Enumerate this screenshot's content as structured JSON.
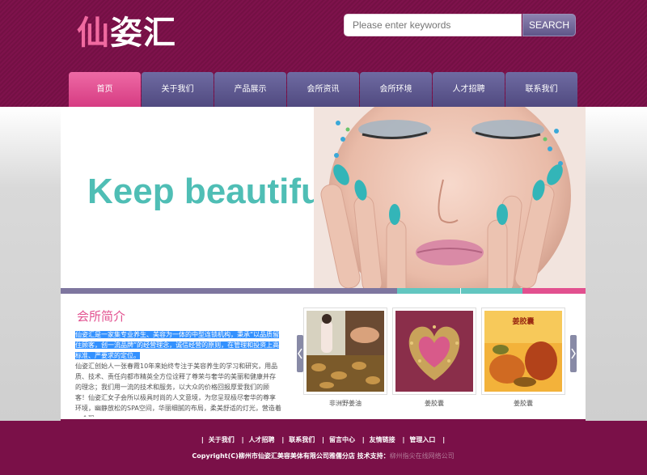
{
  "header": {
    "logo_first": "仙",
    "logo_rest": "姿汇",
    "search_placeholder": "Please enter keywords",
    "search_button": "SEARCH"
  },
  "nav": {
    "items": [
      "首页",
      "关于我们",
      "产品展示",
      "会所资讯",
      "会所环境",
      "人才招聘",
      "联系我们"
    ],
    "active_index": 0
  },
  "banner": {
    "text": "Keep beautiful"
  },
  "strip_colors": [
    "#7e769f",
    "#62c6c0",
    "#e2508f"
  ],
  "intro": {
    "title": "会所简介",
    "highlight": "仙姿汇是一家集专业养生、美容为一体的中型连锁机构，秉承“以品质留住顾客，创一流品牌”的经营理念，诚信经营的原则，在管理和投资上高标准、严要求的定位。",
    "body": "仙姿汇创始人一张春霞10年来始终专注于美容养生的学习和研究，用品质、技术、责任向都市精英全方位诠释了尊荣与奢华的美丽和健康并存的理念；我们用一流的技术和服务，以大众的价格回报厚爱我们的顾客！仙姿汇女子会所以极具时尚的人文意境，为您呈现极尽奢华的尊享环境，幽静放松的SPA空间，华丽细腻的布局，柔美舒适的灯光，营造着一个现"
  },
  "products": [
    {
      "caption": "非洲野姜油"
    },
    {
      "caption": "姜胶囊"
    },
    {
      "caption": "姜胶囊",
      "label": "姜胶囊"
    }
  ],
  "footer": {
    "links": [
      "关于我们",
      "人才招聘",
      "联系我们",
      "留言中心",
      "友情链接",
      "管理入口"
    ],
    "copyright": "Copyright(C)柳州市仙姿汇美容美体有限公司雅儒分店 技术支持：",
    "support": "柳州指尖在线网络公司"
  },
  "colors": {
    "brand": "#7a1048",
    "accent": "#e2508f",
    "nav": "#5f5a90",
    "banner_text": "#4fbeb5"
  }
}
